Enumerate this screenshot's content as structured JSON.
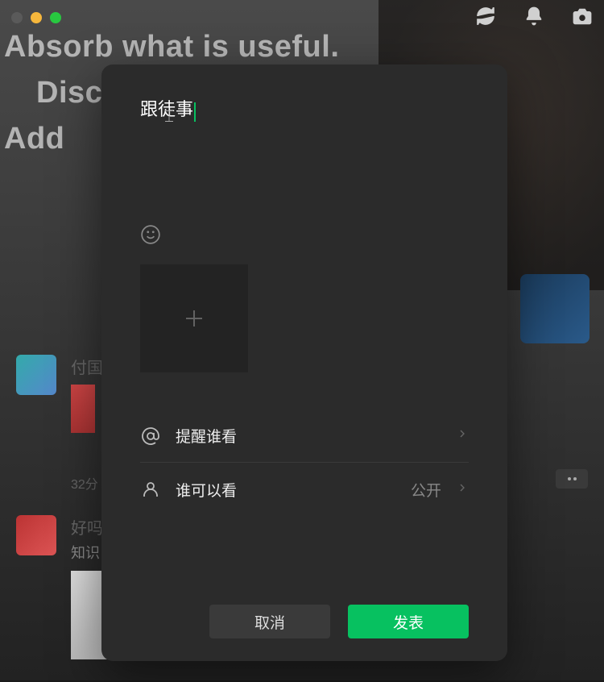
{
  "bg": {
    "line1": "Absorb what is useful.",
    "line2": "Disc",
    "line3": "Add"
  },
  "feed": {
    "item1_name": "付国",
    "item1_time": "32分",
    "item2_name": "好吗",
    "item2_line2": "知识"
  },
  "compose": {
    "text": "跟徒事"
  },
  "options": {
    "mention_label": "提醒谁看",
    "visibility_label": "谁可以看",
    "visibility_value": "公开"
  },
  "actions": {
    "cancel": "取消",
    "publish": "发表"
  }
}
